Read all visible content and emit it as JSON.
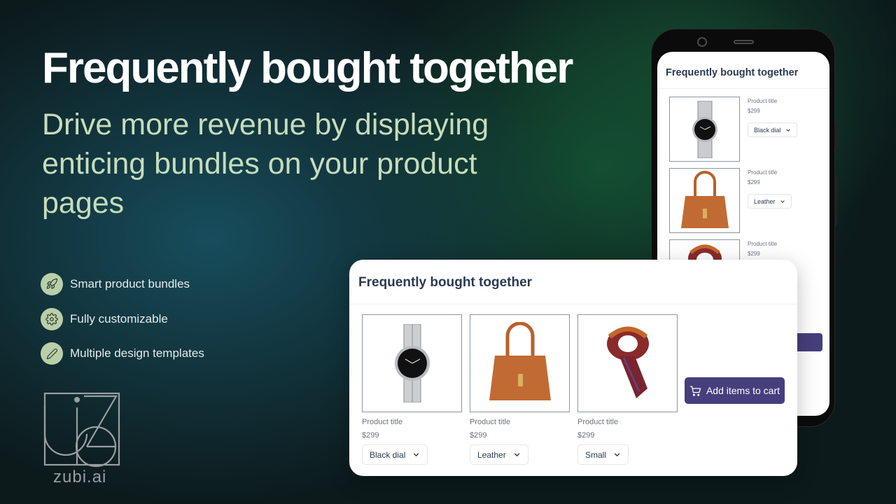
{
  "hero": {
    "headline": "Frequently bought together",
    "subline": "Drive more revenue by displaying enticing bundles on your product pages"
  },
  "features": [
    {
      "icon": "rocket-icon",
      "label": "Smart product bundles"
    },
    {
      "icon": "gear-icon",
      "label": "Fully customizable"
    },
    {
      "icon": "pencil-icon",
      "label": "Multiple design templates"
    }
  ],
  "brand": {
    "name": "zubi.ai"
  },
  "phone_widget": {
    "title": "Frequently bought together",
    "items": [
      {
        "image": "watch",
        "title": "Product title",
        "price": "$299",
        "variant": "Black dial"
      },
      {
        "image": "handbag",
        "title": "Product title",
        "price": "$299",
        "variant": "Leather"
      },
      {
        "image": "scarf",
        "title": "Product title",
        "price": "$299"
      }
    ]
  },
  "card_widget": {
    "title": "Frequently bought together",
    "items": [
      {
        "image": "watch",
        "title": "Product title",
        "price": "$299",
        "variant": "Black dial"
      },
      {
        "image": "handbag",
        "title": "Product title",
        "price": "$299",
        "variant": "Leather"
      },
      {
        "image": "scarf",
        "title": "Product title",
        "price": "$299",
        "variant": "Small"
      }
    ],
    "cart_button": {
      "icon": "cart-icon",
      "label": "Add items to cart"
    }
  },
  "colors": {
    "accent": "#463f7d",
    "feature_badge": "#b9cfaa",
    "subline": "#c6dcbb",
    "heading": "#2a3a52"
  }
}
